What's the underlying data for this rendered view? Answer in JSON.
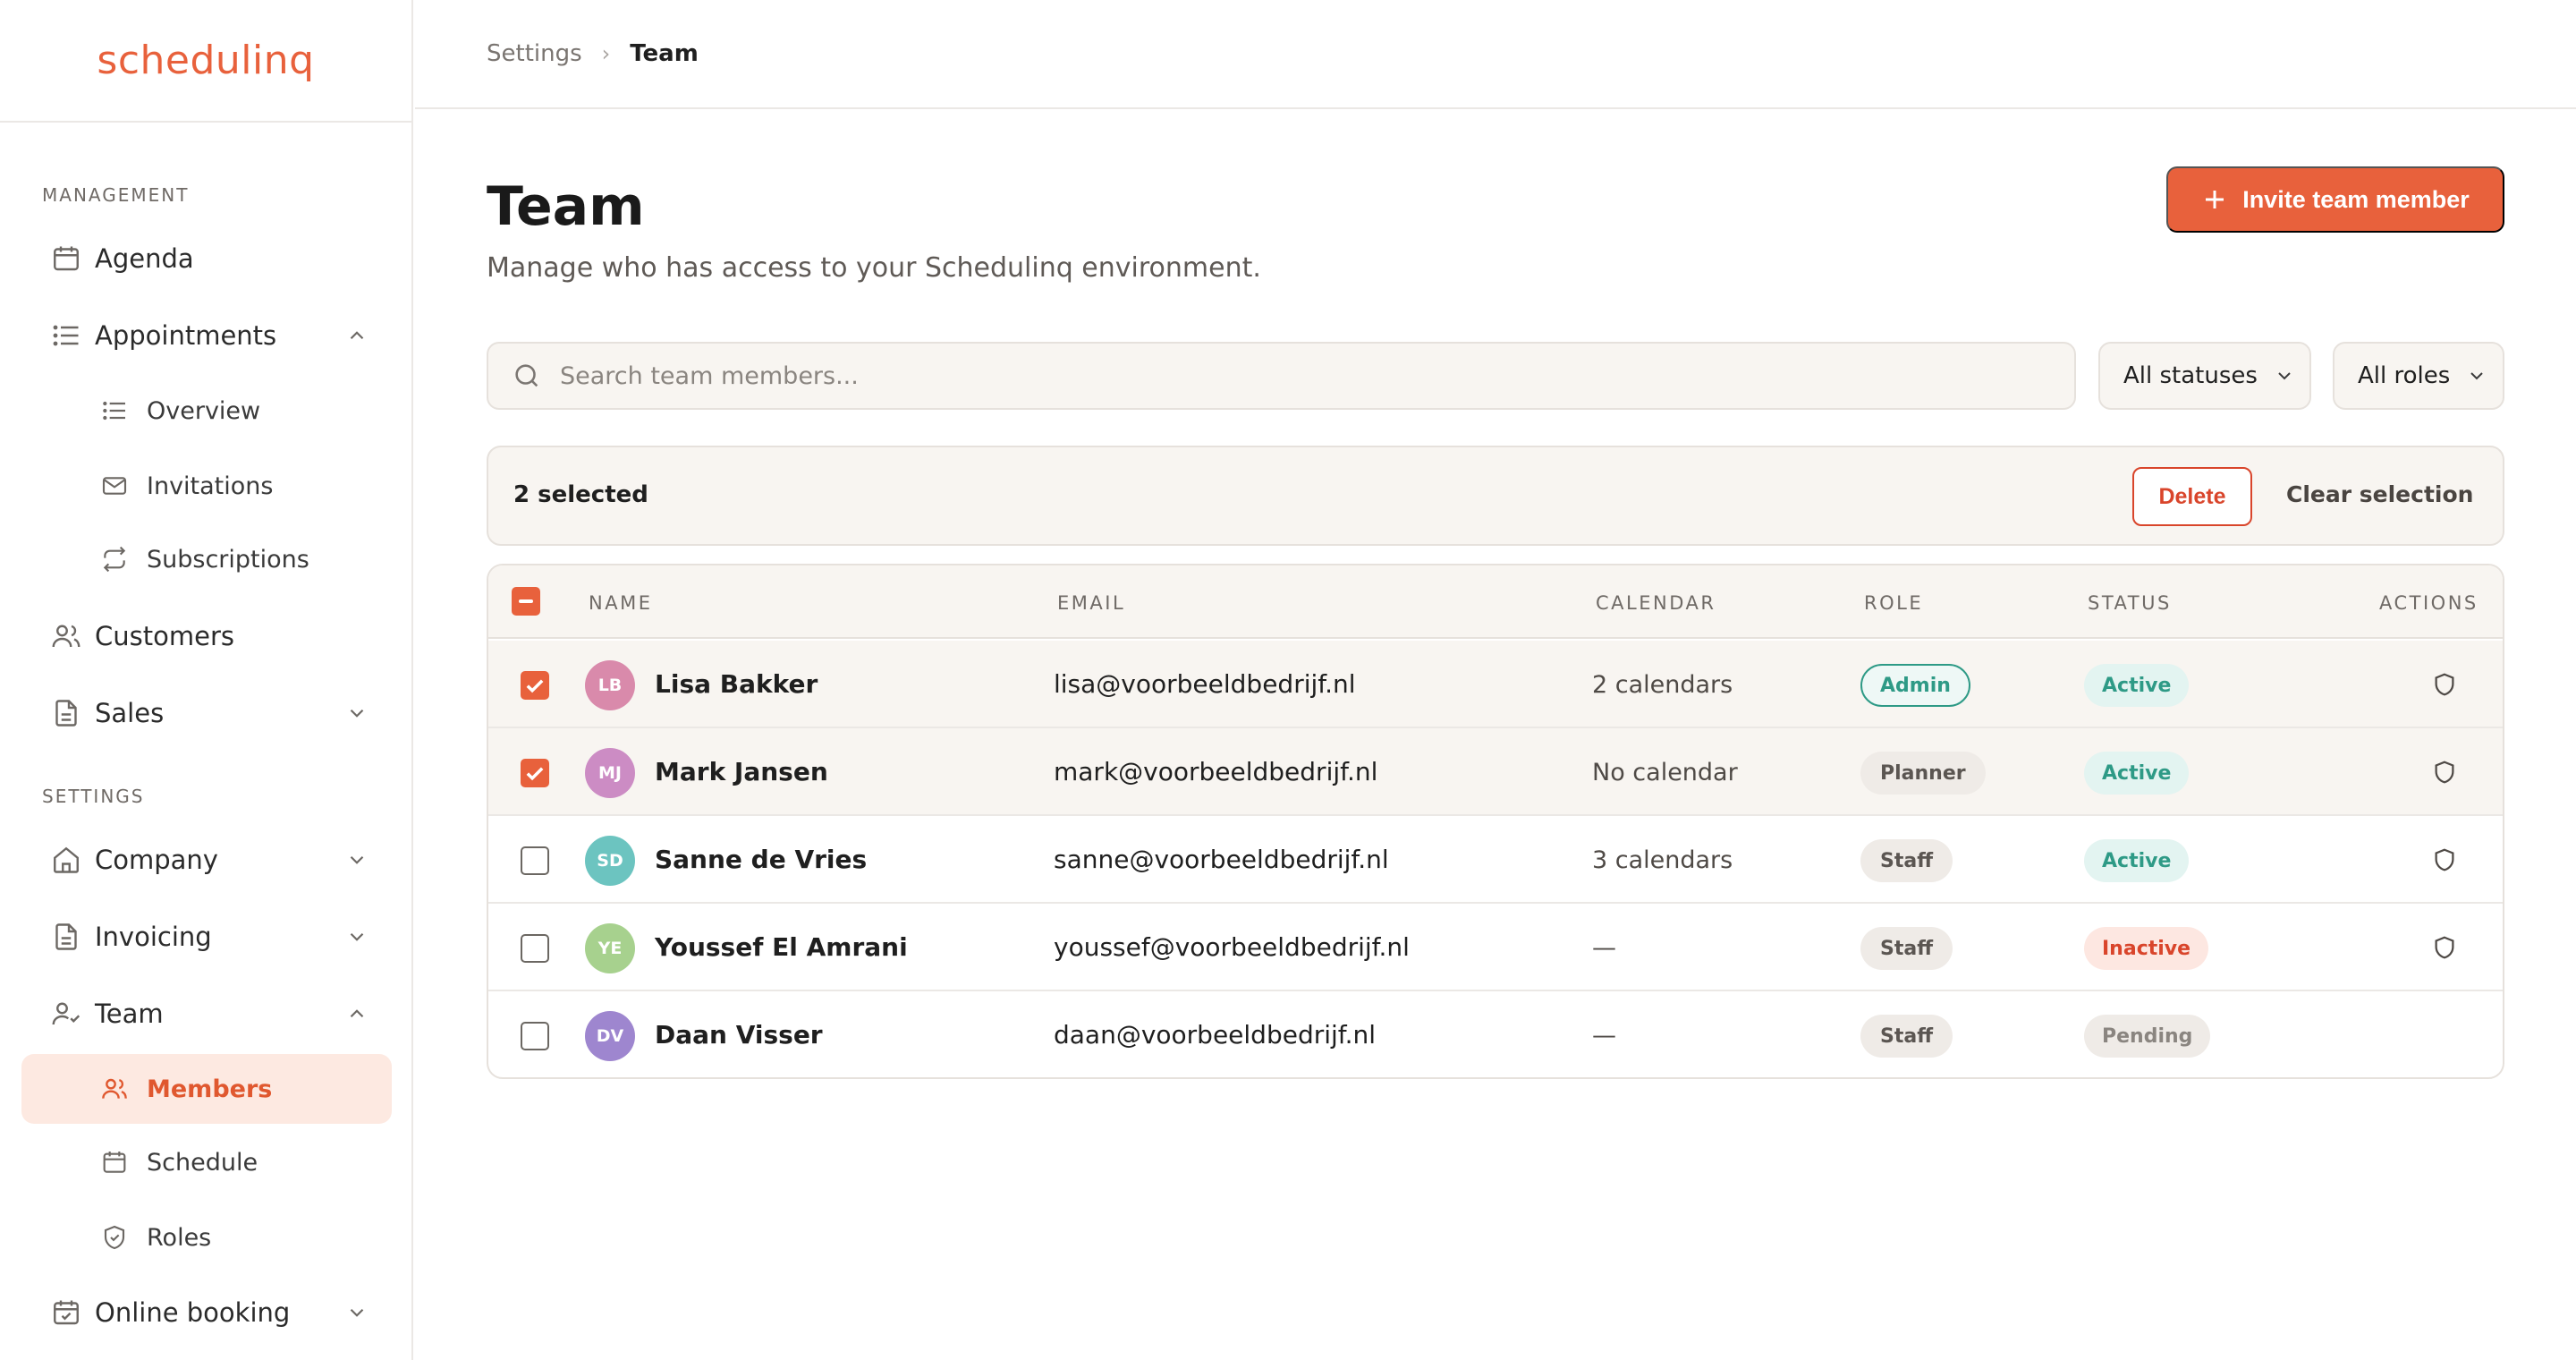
{
  "brand": {
    "logo": "schedulinq",
    "accent": "#e8613c"
  },
  "sidebar": {
    "sections": {
      "management": "MANAGEMENT",
      "settings": "SETTINGS"
    },
    "items": {
      "agenda": "Agenda",
      "appointments": "Appointments",
      "overview": "Overview",
      "invitations": "Invitations",
      "subscriptions": "Subscriptions",
      "customers": "Customers",
      "sales": "Sales",
      "company": "Company",
      "invoicing": "Invoicing",
      "team": "Team",
      "members": "Members",
      "schedule": "Schedule",
      "roles": "Roles",
      "online_booking": "Online booking"
    },
    "active": "members"
  },
  "breadcrumb": {
    "parent": "Settings",
    "current": "Team"
  },
  "page": {
    "title": "Team",
    "subtitle": "Manage who has access to your Schedulinq environment.",
    "invite_label": "Invite team member"
  },
  "filters": {
    "search_placeholder": "Search team members...",
    "status": "All statuses",
    "role": "All roles"
  },
  "bulk": {
    "count_label": "2 selected",
    "delete_label": "Delete",
    "clear_label": "Clear selection"
  },
  "table": {
    "headers": {
      "name": "NAME",
      "email": "EMAIL",
      "calendar": "CALENDAR",
      "role": "ROLE",
      "status": "STATUS",
      "actions": "ACTIONS"
    },
    "rows": [
      {
        "initials": "LB",
        "name": "Lisa Bakker",
        "email": "lisa@voorbeeldbedrijf.nl",
        "calendar": "2 calendars",
        "role": "Admin",
        "status": "Active",
        "selected": true,
        "avatar_color": "#d98aab",
        "action_icon": "shield-icon"
      },
      {
        "initials": "MJ",
        "name": "Mark Jansen",
        "email": "mark@voorbeeldbedrijf.nl",
        "calendar": "No calendar",
        "role": "Planner",
        "status": "Active",
        "selected": true,
        "avatar_color": "#cc8cc4",
        "action_icon": "shield-icon"
      },
      {
        "initials": "SD",
        "name": "Sanne de Vries",
        "email": "sanne@voorbeeldbedrijf.nl",
        "calendar": "3 calendars",
        "role": "Staff",
        "status": "Active",
        "selected": false,
        "avatar_color": "#6cc4c0",
        "action_icon": "shield-icon"
      },
      {
        "initials": "YE",
        "name": "Youssef El Amrani",
        "email": "youssef@voorbeeldbedrijf.nl",
        "calendar": "—",
        "role": "Staff",
        "status": "Inactive",
        "selected": false,
        "avatar_color": "#a7d18e",
        "action_icon": "shield-icon"
      },
      {
        "initials": "DV",
        "name": "Daan Visser",
        "email": "daan@voorbeeldbedrijf.nl",
        "calendar": "—",
        "role": "Staff",
        "status": "Pending",
        "selected": false,
        "avatar_color": "#9e86cf",
        "action_icon": ""
      }
    ]
  }
}
